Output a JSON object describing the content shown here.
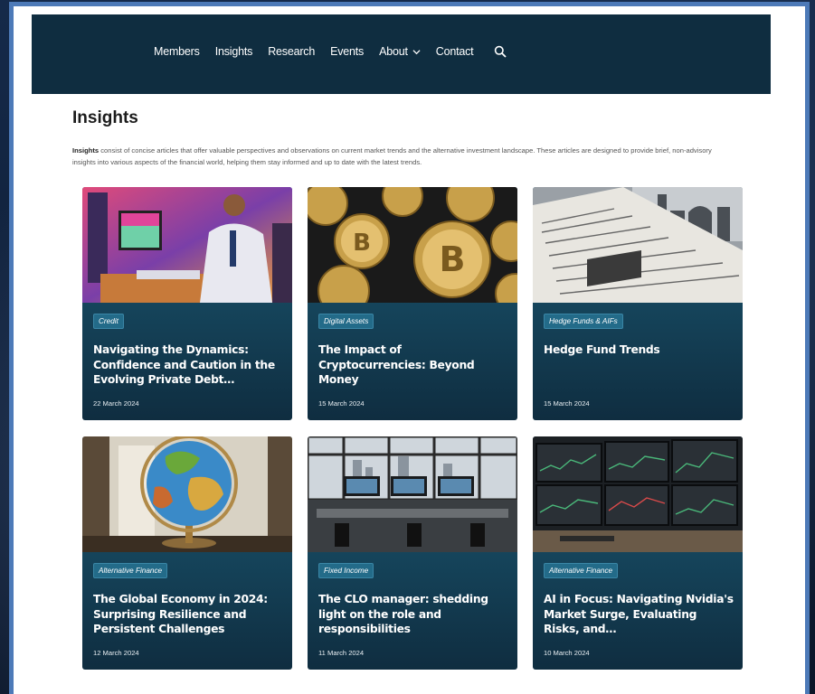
{
  "nav": {
    "items": [
      "Members",
      "Insights",
      "Research",
      "Events",
      "About",
      "Contact"
    ]
  },
  "page": {
    "title": "Insights",
    "intro_bold": "Insights",
    "intro_text": " consist of concise articles that offer valuable perspectives and observations on current market trends and the alternative investment landscape. These articles are designed to provide brief, non-advisory insights into various aspects of the financial world, helping them stay informed and up to date with the latest trends."
  },
  "cards": [
    {
      "tag": "Credit",
      "title": "Navigating the Dynamics: Confidence and Caution in the Evolving Private Debt…",
      "date": "22 March 2024"
    },
    {
      "tag": "Digital Assets",
      "title": "The Impact of Cryptocurrencies: Beyond Money",
      "date": "15 March 2024"
    },
    {
      "tag": "Hedge Funds & AIFs",
      "title": "Hedge Fund Trends",
      "date": "15 March 2024"
    },
    {
      "tag": "Alternative Finance",
      "title": "The Global Economy in 2024: Surprising Resilience and Persistent Challenges",
      "date": "12 March 2024"
    },
    {
      "tag": "Fixed Income",
      "title": "The CLO manager: shedding light on the role and responsibilities",
      "date": "11 March 2024"
    },
    {
      "tag": "Alternative Finance",
      "title": "AI in Focus: Navigating Nvidia's Market Surge, Evaluating Risks, and…",
      "date": "10 March 2024"
    }
  ],
  "icons": {
    "search": "search-icon",
    "chevron": "chevron-down-icon"
  },
  "colors": {
    "header_bg": "#0f2d40",
    "card_top": "#1f5f7b",
    "card_bottom": "#0f2d40",
    "frame_border": "#4d7ab8"
  }
}
